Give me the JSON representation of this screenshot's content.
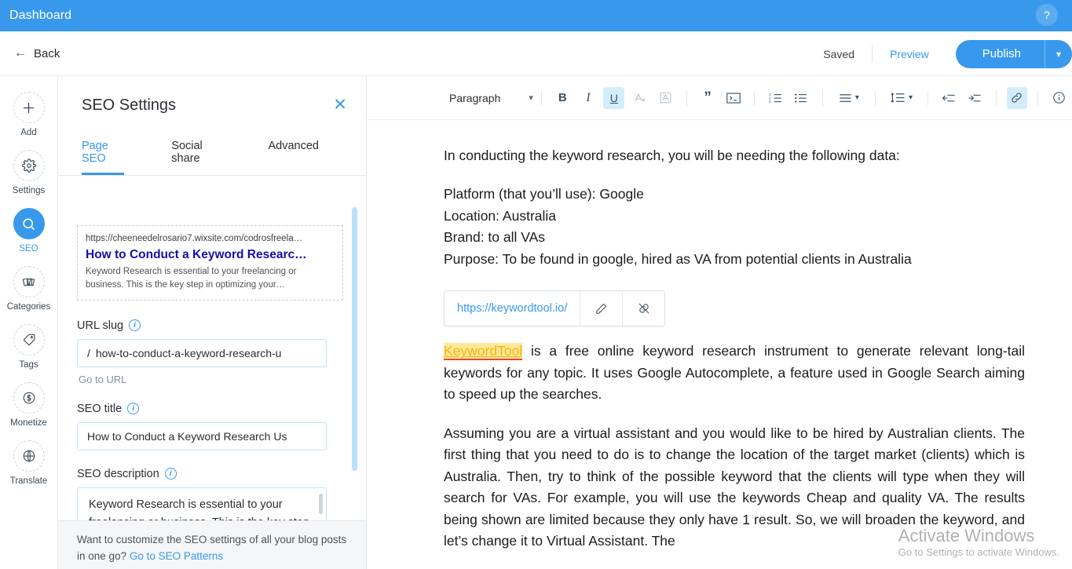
{
  "app_bar": {
    "title": "Dashboard",
    "help_icon": "question-mark-icon",
    "background": "#3899ec"
  },
  "top_bar": {
    "back_label": "Back",
    "back_icon": "arrow-left-icon",
    "saved_label": "Saved",
    "preview_label": "Preview",
    "publish_label": "Publish",
    "publish_caret_icon": "chevron-down-icon"
  },
  "rail": {
    "items": [
      {
        "label": "Add",
        "icon": "plus-icon",
        "active": false
      },
      {
        "label": "Settings",
        "icon": "gear-icon",
        "active": false
      },
      {
        "label": "SEO",
        "icon": "search-icon",
        "active": true
      },
      {
        "label": "Categories",
        "icon": "cards-icon",
        "active": false
      },
      {
        "label": "Tags",
        "icon": "tag-icon",
        "active": false
      },
      {
        "label": "Monetize",
        "icon": "dollar-icon",
        "active": false
      },
      {
        "label": "Translate",
        "icon": "globe-icon",
        "active": false
      }
    ]
  },
  "seo_panel": {
    "title": "SEO Settings",
    "close_icon": "close-icon",
    "tabs": [
      {
        "label": "Page SEO",
        "active": true
      },
      {
        "label": "Social share",
        "active": false
      },
      {
        "label": "Advanced",
        "active": false
      }
    ],
    "serp_preview": {
      "url": "https://cheeneedelrosario7.wixsite.com/codrosfreela…",
      "title": "How to Conduct a Keyword Researc…",
      "description": "Keyword Research is essential to your freelancing or business. This is the key step in optimizing your…"
    },
    "url_slug": {
      "label": "URL slug",
      "info_icon": "info-icon",
      "prefix": "/",
      "value": "how-to-conduct-a-keyword-research-u",
      "go_to_url_label": "Go to URL"
    },
    "seo_title": {
      "label": "SEO title",
      "info_icon": "info-icon",
      "value": "How to Conduct a Keyword Research Us"
    },
    "seo_description": {
      "label": "SEO description",
      "info_icon": "info-icon",
      "value": "Keyword Research is essential to your freelancing or business. This is the key step in optimizing your"
    },
    "footer": {
      "text": "Want to customize the SEO settings of all your blog posts in one go? ",
      "link_label": "Go to SEO Patterns"
    }
  },
  "editor_toolbar": {
    "paragraph_label": "Paragraph",
    "paragraph_caret": "chevron-down-icon",
    "buttons": [
      {
        "name": "bold",
        "glyph": "B",
        "state": "off"
      },
      {
        "name": "italic",
        "glyph": "I",
        "state": "off"
      },
      {
        "name": "underline",
        "glyph": "U",
        "state": "on"
      },
      {
        "name": "text-color",
        "glyph": "A",
        "state": "dim"
      },
      {
        "name": "text-highlight",
        "glyph": "A",
        "state": "dim"
      },
      {
        "name": "blockquote",
        "glyph": "”",
        "state": "off"
      },
      {
        "name": "code-block",
        "glyph": ">_",
        "state": "off"
      },
      {
        "name": "ordered-list",
        "glyph": "1.",
        "state": "off"
      },
      {
        "name": "bulleted-list",
        "glyph": "•",
        "state": "off"
      },
      {
        "name": "text-align",
        "glyph": "≡",
        "state": "off"
      },
      {
        "name": "line-spacing",
        "glyph": "↕≡",
        "state": "off"
      },
      {
        "name": "outdent",
        "glyph": "←≡",
        "state": "off"
      },
      {
        "name": "indent",
        "glyph": "→≡",
        "state": "off"
      },
      {
        "name": "insert-link",
        "glyph": "🔗",
        "state": "on"
      },
      {
        "name": "info",
        "glyph": "i",
        "state": "off"
      }
    ]
  },
  "document": {
    "para_1": "In conducting the keyword research, you will be needing the following data:",
    "lines": [
      "Platform (that you’ll use): Google",
      "Location: Australia",
      "Brand: to all VAs",
      "Purpose: To be found in google, hired as VA from potential clients in Australia"
    ],
    "link_popup": {
      "url": "https://keywordtool.io/",
      "edit_icon": "pencil-icon",
      "unlink_icon": "unlink-icon"
    },
    "para_2_link": "KeywordTool",
    "para_2_rest": " is a free online keyword research instrument to generate relevant long-tail keywords for any topic. It uses Google Autocomplete, a feature used in Google Search aiming to speed up the searches.",
    "para_3": "Assuming you are a virtual assistant and you would like to be hired by Australian clients. The first thing that you need to do is to change the location of the target market (clients) which is Australia. Then, try to think of the possible keyword that the clients will type when they will search for VAs. For example, you will use the keywords Cheap and quality VA. The results being shown are limited because they only have 1 result. So, we will broaden the keyword, and let’s change it to Virtual Assistant. The"
  },
  "watermark": {
    "line1": "Activate Windows",
    "line2": "Go to Settings to activate Windows."
  }
}
